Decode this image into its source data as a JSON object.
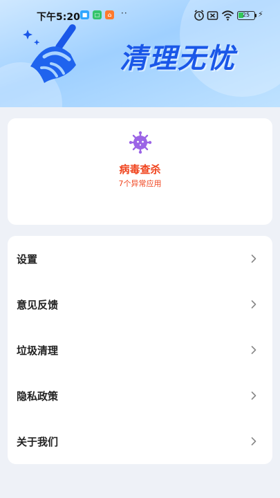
{
  "statusbar": {
    "time": "下午5:20",
    "battery": "25",
    "dots": "··"
  },
  "header": {
    "title": "清理无忧"
  },
  "virus_card": {
    "title": "病毒查杀",
    "subtitle": "7个异常应用",
    "accent_color": "#f0441e",
    "icon": "virus-icon"
  },
  "menu": {
    "items": [
      {
        "label": "设置"
      },
      {
        "label": "意见反馈"
      },
      {
        "label": "垃圾清理"
      },
      {
        "label": "隐私政策"
      },
      {
        "label": "关于我们"
      }
    ]
  }
}
